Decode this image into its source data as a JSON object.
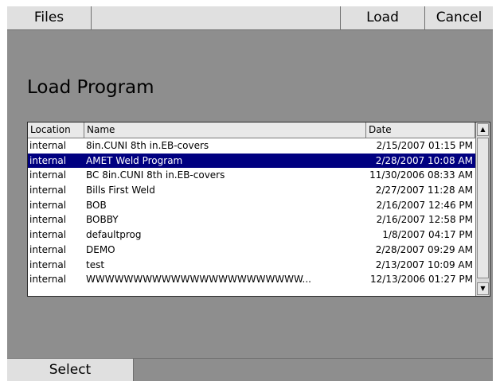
{
  "toolbar": {
    "files_label": "Files",
    "load_label": "Load",
    "cancel_label": "Cancel"
  },
  "page_title": "Load Program",
  "table": {
    "columns": [
      "Location",
      "Name",
      "Date"
    ],
    "rows": [
      {
        "location": "internal",
        "name": "8in.CUNI 8th in.EB-covers",
        "date": "2/15/2007 01:15 PM"
      },
      {
        "location": "internal",
        "name": "AMET Weld Program",
        "date": "2/28/2007 10:08 AM"
      },
      {
        "location": "internal",
        "name": "BC 8in.CUNI 8th in.EB-covers",
        "date": "11/30/2006 08:33 AM"
      },
      {
        "location": "internal",
        "name": "Bills First Weld",
        "date": "2/27/2007 11:28 AM"
      },
      {
        "location": "internal",
        "name": "BOB",
        "date": "2/16/2007 12:46 PM"
      },
      {
        "location": "internal",
        "name": "BOBBY",
        "date": "2/16/2007 12:58 PM"
      },
      {
        "location": "internal",
        "name": "defaultprog",
        "date": "1/8/2007 04:17 PM"
      },
      {
        "location": "internal",
        "name": "DEMO",
        "date": "2/28/2007 09:29 AM"
      },
      {
        "location": "internal",
        "name": "test",
        "date": "2/13/2007 10:09 AM"
      },
      {
        "location": "internal",
        "name": "WWWWWWWWWWWWWWWWWWWWWWW...",
        "date": "12/13/2006 01:27 PM"
      }
    ],
    "selected_index": 1
  },
  "scrollbar": {
    "up_icon": "up-arrow-icon",
    "down_icon": "down-arrow-icon"
  },
  "bottom": {
    "select_label": "Select"
  },
  "colors": {
    "selection_bg": "#000080",
    "panel_bg": "#8e8e8e",
    "button_bg": "#e0e0e0"
  }
}
